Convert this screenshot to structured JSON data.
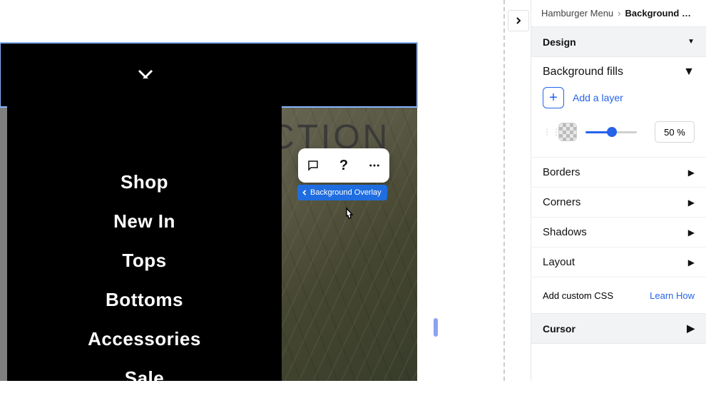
{
  "breadcrumb": {
    "parent": "Hamburger Menu",
    "current": "Background Ove…"
  },
  "sections": {
    "design": "Design",
    "bgfills_title": "Background fills",
    "add_layer": "Add a layer",
    "opacity_value": "50 %",
    "borders": "Borders",
    "corners": "Corners",
    "shadows": "Shadows",
    "layout": "Layout",
    "css_label": "Add custom CSS",
    "css_learn": "Learn How",
    "cursor": "Cursor"
  },
  "canvas": {
    "collection_fragment": "CTION",
    "tag_label": "Background Overlay",
    "menu_items": [
      "Shop",
      "New In",
      "Tops",
      "Bottoms",
      "Accessories",
      "Sale"
    ]
  }
}
